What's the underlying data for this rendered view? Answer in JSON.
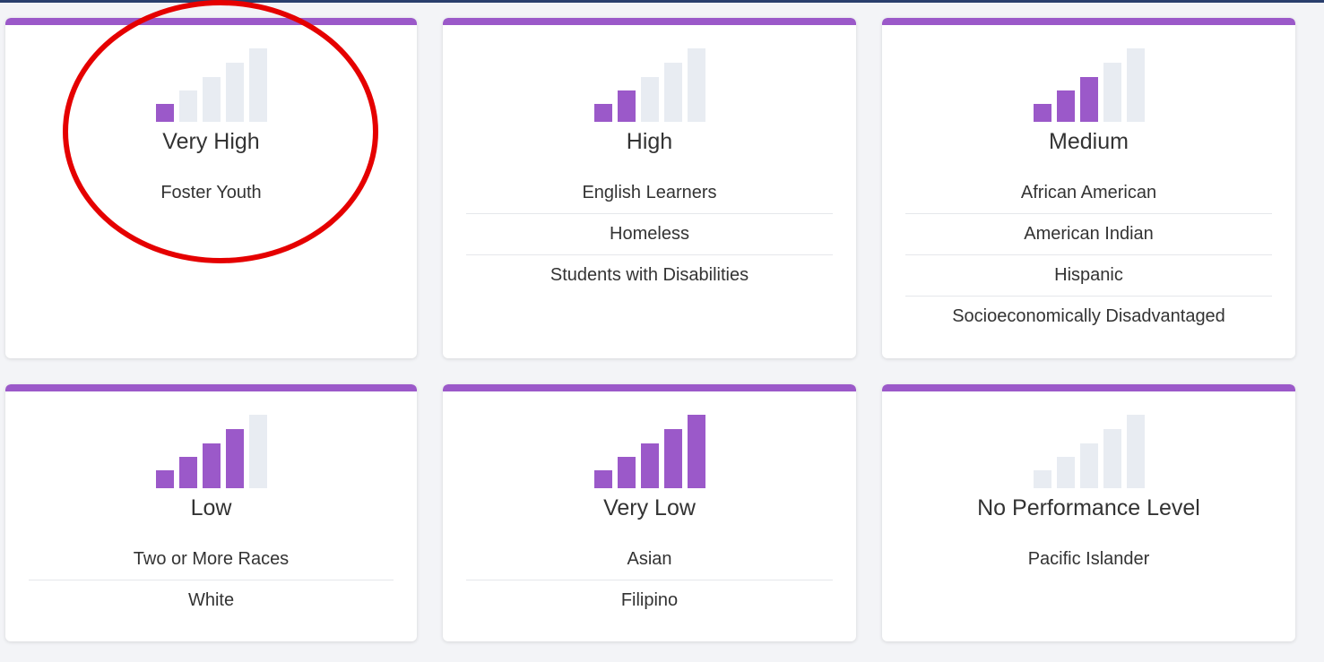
{
  "colors": {
    "accent": "#9b59c9",
    "bar_empty": "#e8ecf2",
    "annotation": "#e50000"
  },
  "cards": [
    {
      "level": "Very High",
      "filled_bars": 1,
      "groups": [
        "Foster Youth"
      ]
    },
    {
      "level": "High",
      "filled_bars": 2,
      "groups": [
        "English Learners",
        "Homeless",
        "Students with Disabilities"
      ]
    },
    {
      "level": "Medium",
      "filled_bars": 3,
      "groups": [
        "African American",
        "American Indian",
        "Hispanic",
        "Socioeconomically Disadvantaged"
      ]
    },
    {
      "level": "Low",
      "filled_bars": 4,
      "groups": [
        "Two or More Races",
        "White"
      ]
    },
    {
      "level": "Very Low",
      "filled_bars": 5,
      "groups": [
        "Asian",
        "Filipino"
      ]
    },
    {
      "level": "No Performance Level",
      "filled_bars": 0,
      "groups": [
        "Pacific Islander"
      ]
    }
  ]
}
